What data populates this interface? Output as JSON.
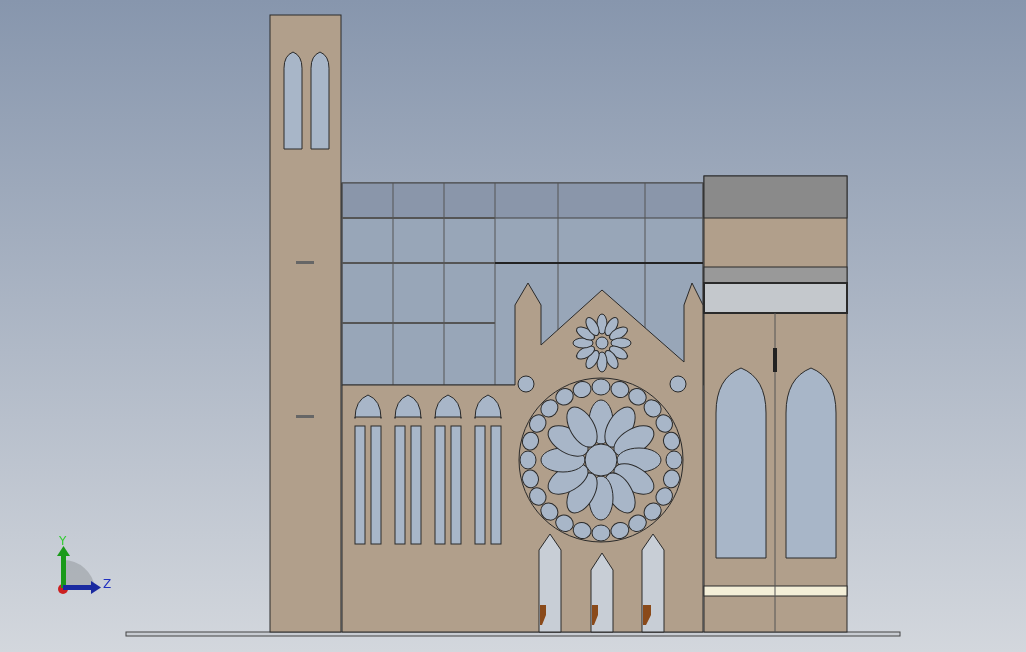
{
  "viewport": {
    "triad": {
      "axes": [
        {
          "kind": "y",
          "label": "Y"
        },
        {
          "kind": "z",
          "label": "Z"
        }
      ]
    }
  }
}
